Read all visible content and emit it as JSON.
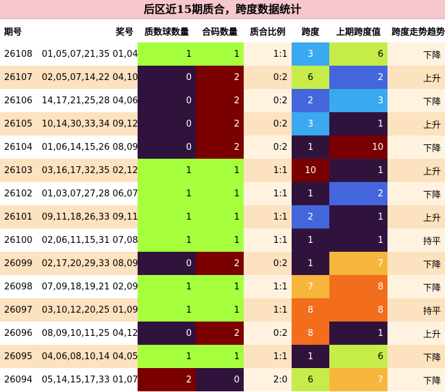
{
  "title": "后区近15期质合，跨度数据统计",
  "headers": [
    "期号",
    "奖号",
    "质数球数量",
    "合码数量",
    "质合比例",
    "跨度",
    "上期跨度值",
    "跨度走势趋势"
  ],
  "colors": {
    "green": "#a6ff3c",
    "dark_purple": "#30133d",
    "maroon": "#7b0000",
    "light_blue": "#3aa9f0",
    "lime": "#c6ec4a",
    "blue": "#4466dd",
    "dark_red": "#780000",
    "orange": "#f2a43c",
    "orange_bright": "#f26d1c",
    "light_orange": "#f6b63c"
  },
  "rows": [
    {
      "issue": "26108",
      "front": "01,05,07,21,35",
      "back": "01,04",
      "prime": "1",
      "composite": "1",
      "ratio": "1:1",
      "span": "3",
      "prev_span": "6",
      "trend": "下降",
      "prime_c": "green",
      "comp_c": "green",
      "span_c": "light_blue",
      "prev_c": "lime"
    },
    {
      "issue": "26107",
      "front": "02,05,07,14,22",
      "back": "04,10",
      "prime": "0",
      "composite": "2",
      "ratio": "0:2",
      "span": "6",
      "prev_span": "2",
      "trend": "上升",
      "prime_c": "dark_purple",
      "comp_c": "maroon",
      "span_c": "lime",
      "prev_c": "blue"
    },
    {
      "issue": "26106",
      "front": "14,17,21,25,28",
      "back": "04,06",
      "prime": "0",
      "composite": "2",
      "ratio": "0:2",
      "span": "2",
      "prev_span": "3",
      "trend": "下降",
      "prime_c": "dark_purple",
      "comp_c": "maroon",
      "span_c": "blue",
      "prev_c": "light_blue"
    },
    {
      "issue": "26105",
      "front": "10,14,30,33,34",
      "back": "09,12",
      "prime": "0",
      "composite": "2",
      "ratio": "0:2",
      "span": "3",
      "prev_span": "1",
      "trend": "上升",
      "prime_c": "dark_purple",
      "comp_c": "maroon",
      "span_c": "light_blue",
      "prev_c": "dark_purple"
    },
    {
      "issue": "26104",
      "front": "01,06,14,15,26",
      "back": "08,09",
      "prime": "0",
      "composite": "2",
      "ratio": "0:2",
      "span": "1",
      "prev_span": "10",
      "trend": "下降",
      "prime_c": "dark_purple",
      "comp_c": "maroon",
      "span_c": "dark_purple",
      "prev_c": "dark_red"
    },
    {
      "issue": "26103",
      "front": "03,16,17,32,35",
      "back": "02,12",
      "prime": "1",
      "composite": "1",
      "ratio": "1:1",
      "span": "10",
      "prev_span": "1",
      "trend": "上升",
      "prime_c": "green",
      "comp_c": "green",
      "span_c": "dark_red",
      "prev_c": "dark_purple"
    },
    {
      "issue": "26102",
      "front": "01,03,07,27,28",
      "back": "06,07",
      "prime": "1",
      "composite": "1",
      "ratio": "1:1",
      "span": "1",
      "prev_span": "2",
      "trend": "下降",
      "prime_c": "green",
      "comp_c": "green",
      "span_c": "dark_purple",
      "prev_c": "blue"
    },
    {
      "issue": "26101",
      "front": "09,11,18,26,33",
      "back": "09,11",
      "prime": "1",
      "composite": "1",
      "ratio": "1:1",
      "span": "2",
      "prev_span": "1",
      "trend": "上升",
      "prime_c": "green",
      "comp_c": "green",
      "span_c": "blue",
      "prev_c": "dark_purple"
    },
    {
      "issue": "26100",
      "front": "02,06,11,15,31",
      "back": "07,08",
      "prime": "1",
      "composite": "1",
      "ratio": "1:1",
      "span": "1",
      "prev_span": "1",
      "trend": "持平",
      "prime_c": "green",
      "comp_c": "green",
      "span_c": "dark_purple",
      "prev_c": "dark_purple"
    },
    {
      "issue": "26099",
      "front": "02,17,20,29,33",
      "back": "08,09",
      "prime": "0",
      "composite": "2",
      "ratio": "0:2",
      "span": "1",
      "prev_span": "7",
      "trend": "下降",
      "prime_c": "dark_purple",
      "comp_c": "maroon",
      "span_c": "dark_purple",
      "prev_c": "light_orange"
    },
    {
      "issue": "26098",
      "front": "07,09,18,19,21",
      "back": "02,09",
      "prime": "1",
      "composite": "1",
      "ratio": "1:1",
      "span": "7",
      "prev_span": "8",
      "trend": "下降",
      "prime_c": "green",
      "comp_c": "green",
      "span_c": "light_orange",
      "prev_c": "orange_bright"
    },
    {
      "issue": "26097",
      "front": "03,10,12,20,25",
      "back": "01,09",
      "prime": "1",
      "composite": "1",
      "ratio": "1:1",
      "span": "8",
      "prev_span": "8",
      "trend": "持平",
      "prime_c": "green",
      "comp_c": "green",
      "span_c": "orange_bright",
      "prev_c": "orange_bright"
    },
    {
      "issue": "26096",
      "front": "08,09,10,11,25",
      "back": "04,12",
      "prime": "0",
      "composite": "2",
      "ratio": "0:2",
      "span": "8",
      "prev_span": "1",
      "trend": "上升",
      "prime_c": "dark_purple",
      "comp_c": "maroon",
      "span_c": "orange_bright",
      "prev_c": "dark_purple"
    },
    {
      "issue": "26095",
      "front": "04,06,08,10,14",
      "back": "04,05",
      "prime": "1",
      "composite": "1",
      "ratio": "1:1",
      "span": "1",
      "prev_span": "6",
      "trend": "下降",
      "prime_c": "green",
      "comp_c": "green",
      "span_c": "dark_purple",
      "prev_c": "lime"
    },
    {
      "issue": "26094",
      "front": "05,14,15,17,33",
      "back": "01,07",
      "prime": "2",
      "composite": "0",
      "ratio": "2:0",
      "span": "6",
      "prev_span": "7",
      "trend": "下降",
      "prime_c": "maroon",
      "comp_c": "dark_purple",
      "span_c": "lime",
      "prev_c": "light_orange"
    }
  ]
}
